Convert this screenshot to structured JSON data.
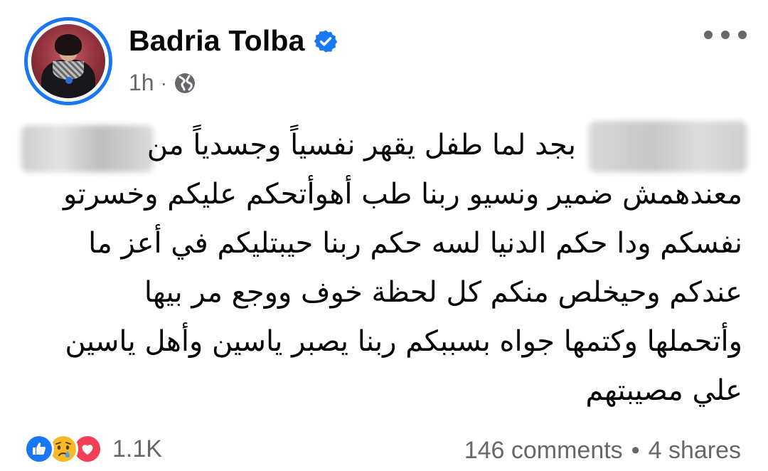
{
  "header": {
    "author_name": "Badria Tolba",
    "verified_icon": "verified-badge-icon",
    "timestamp": "1h",
    "meta_separator": "·",
    "audience_icon": "globe-icon",
    "more_icon": "more-options-icon"
  },
  "post": {
    "lines": [
      "بجد لما طفل يقهر نفسياً وجسدياً من",
      "معندهمش ضمير ونسيو ربنا طب أهوأتحكم  عليكم وخسرتو",
      "نفسكم ودا حكم الدنيا لسه حكم ربنا حيبتليكم في أعز ما",
      "عندكم وحيخلص منكم كل لحظة خوف ووجع مر بيها",
      "وأتحملها وكتمها جواه بسببكم ربنا يصبر ياسين وأهل ياسين",
      "علي مصيبتهم"
    ]
  },
  "footer": {
    "reaction_icons": [
      "like-reaction-icon",
      "sad-reaction-icon",
      "love-reaction-icon"
    ],
    "reaction_count": "1.1K",
    "comments": "146 comments",
    "separator": "•",
    "shares": "4 shares"
  },
  "colors": {
    "accent": "#1877f2",
    "secondary_text": "#65676b",
    "love": "#f33e58",
    "sad": "#f7b928"
  }
}
